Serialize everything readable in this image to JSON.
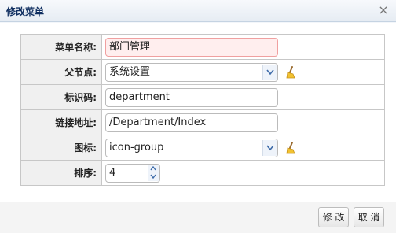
{
  "dialog": {
    "title": "修改菜单",
    "close_glyph": "×"
  },
  "form": {
    "fields": [
      {
        "label": "菜单名称:",
        "value": "部门管理",
        "type": "text",
        "invalid": true
      },
      {
        "label": "父节点:",
        "value": "系统设置",
        "type": "combo",
        "icon": "broom-icon"
      },
      {
        "label": "标识码:",
        "value": "department",
        "type": "text"
      },
      {
        "label": "链接地址:",
        "value": "/Department/Index",
        "type": "text"
      },
      {
        "label": "图标:",
        "value": "icon-group",
        "type": "combo",
        "icon": "broom-icon"
      },
      {
        "label": "排序:",
        "value": "4",
        "type": "spinner"
      }
    ]
  },
  "footer": {
    "edit_label": "修 改",
    "cancel_label": "取 消"
  },
  "colors": {
    "title": "#0e2d5f",
    "invalid_bg": "#ffeeee"
  }
}
